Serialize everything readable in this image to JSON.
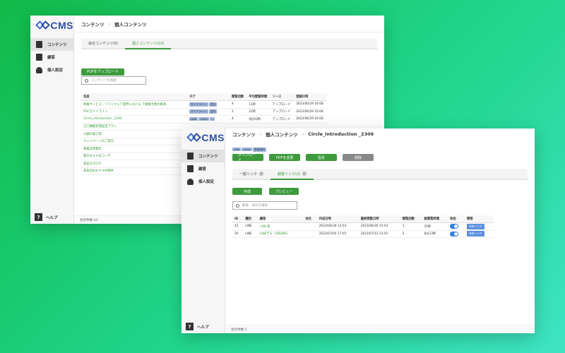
{
  "brand": {
    "name": "CMS"
  },
  "nav": {
    "contents": "コンテンツ",
    "customers": "顧客",
    "personal": "個人設定",
    "help": "ヘルプ"
  },
  "back": {
    "crumb": [
      "コンテンツ",
      "個人コンテンツ"
    ],
    "tabs": [
      "会社コンテンツ(0)",
      "個人コンテンツ(10)"
    ],
    "upload_label": "PDFをアップロード",
    "search_placeholder": "コンテンツを検索",
    "headers": [
      "名前",
      "タグ",
      "閲覧回数",
      "平均閲覧時間",
      "ソース",
      "登録日時"
    ],
    "rows": [
      {
        "name": "情報サービス・ソフトウェア業界における 下請業主数の推移...",
        "tags": [
          "ガイドライン",
          "会社"
        ],
        "views": "4",
        "avg": "11秒",
        "source": "アップロード",
        "date": "2023/06/29 16:08"
      },
      {
        "name": "PDCガイドライン",
        "tags": [
          "ガイドライン",
          "会社"
        ],
        "views": "2",
        "avg": "22秒",
        "source": "アップロード",
        "date": "2023/06/29 16:08"
      },
      {
        "name": "Circle_Introduction _2306",
        "tags": [
          "LINE",
          "circle",
          "..."
        ],
        "views": "4",
        "avg": "9分52秒",
        "source": "アップロード",
        "date": "2023/06/29 16:08"
      },
      {
        "name": "〇〇機能初期設定プラン",
        "tags": [],
        "views": "",
        "avg": "",
        "source": "",
        "date": ""
      },
      {
        "name": "公園の施工例",
        "tags": [],
        "views": "",
        "avg": "",
        "source": "",
        "date": ""
      },
      {
        "name": "キャンペーンのご案内",
        "tags": [],
        "views": "",
        "avg": "",
        "source": "",
        "date": ""
      },
      {
        "name": "事業説明資料",
        "tags": [],
        "views": "",
        "avg": "",
        "source": "",
        "date": ""
      },
      {
        "name": "春のおすすめコーデ",
        "tags": [],
        "views": "",
        "avg": "",
        "source": "",
        "date": ""
      },
      {
        "name": "商品カタログ",
        "tags": [],
        "views": "",
        "avg": "",
        "source": "",
        "date": ""
      },
      {
        "name": "家具別おおすすめ物件",
        "tags": [],
        "views": "",
        "avg": "",
        "source": "",
        "date": ""
      }
    ],
    "total": "合計件数 10"
  },
  "front": {
    "crumb": [
      "コンテンツ",
      "個人コンテンツ",
      "Circle_Introduction _2306"
    ],
    "tags": [
      "LINE",
      "circle",
      "営業資料"
    ],
    "actions": [
      "ダウンロード",
      "PDFを変更",
      "設定",
      "削除"
    ],
    "tabs": [
      "一般リンク",
      "顧客リンク(2)"
    ],
    "create_label": "作成",
    "preview_label": "プレビュー",
    "search_placeholder": "顧客、会社を検索",
    "headers": [
      "ID",
      "種別",
      "顧客",
      "会社",
      "作成日時",
      "最終閲覧日時",
      "閲覧回数",
      "総閲覧時間",
      "有効",
      "管理"
    ],
    "rows": [
      {
        "id": "41",
        "type": "LINE",
        "customer": "小林 潔",
        "company": "",
        "created": "2023/06/30 13:54",
        "last": "2023/06/30 15:54",
        "views": "1",
        "total": "35秒",
        "manage": "共有リンク"
      },
      {
        "id": "50",
        "type": "LINE",
        "customer": "LINEデモ（DBLINE）",
        "company": "",
        "created": "2023/07/04 17:05",
        "last": "2023/07/12 23:55",
        "views": "3",
        "total": "8分23秒",
        "manage": "共有リンク"
      }
    ],
    "total": "合計件数 2"
  }
}
